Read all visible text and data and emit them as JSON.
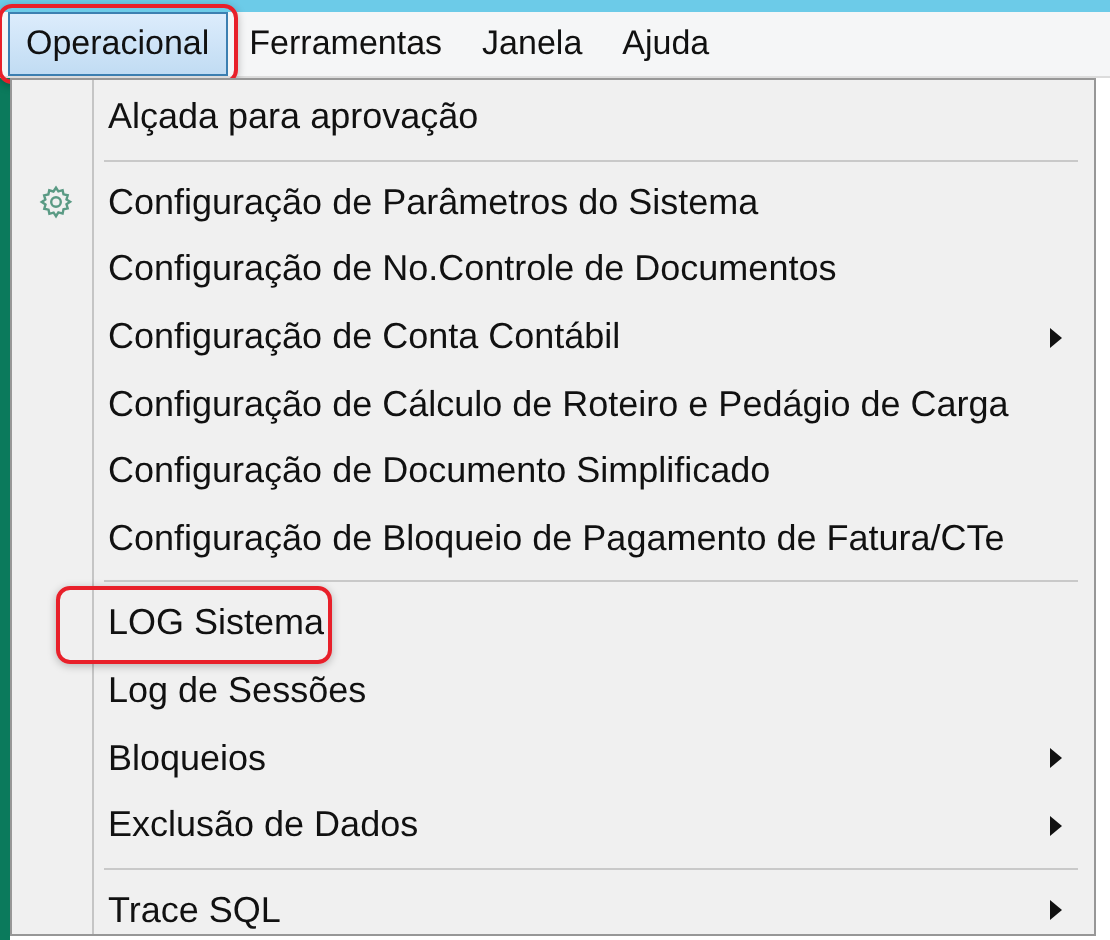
{
  "menubar": [
    {
      "label": "Operacional",
      "selected": true,
      "highlighted": true
    },
    {
      "label": "Ferramentas",
      "selected": false,
      "highlighted": false
    },
    {
      "label": "Janela",
      "selected": false,
      "highlighted": false
    },
    {
      "label": "Ajuda",
      "selected": false,
      "highlighted": false
    }
  ],
  "menu": [
    {
      "kind": "item",
      "label": "Alçada para aprovação",
      "has_icon": false,
      "has_submenu": false,
      "highlighted": false
    },
    {
      "kind": "separator"
    },
    {
      "kind": "item",
      "label": "Configuração de Parâmetros do Sistema",
      "has_icon": true,
      "has_submenu": false,
      "highlighted": false
    },
    {
      "kind": "item",
      "label": "Configuração de No.Controle de Documentos",
      "has_icon": false,
      "has_submenu": false,
      "highlighted": false
    },
    {
      "kind": "item",
      "label": "Configuração de Conta Contábil",
      "has_icon": false,
      "has_submenu": true,
      "highlighted": false
    },
    {
      "kind": "item",
      "label": "Configuração de Cálculo de Roteiro e Pedágio de Carga",
      "has_icon": false,
      "has_submenu": false,
      "highlighted": false
    },
    {
      "kind": "item",
      "label": "Configuração de Documento Simplificado",
      "has_icon": false,
      "has_submenu": false,
      "highlighted": false
    },
    {
      "kind": "item",
      "label": "Configuração de Bloqueio de Pagamento de Fatura/CTe",
      "has_icon": false,
      "has_submenu": false,
      "highlighted": false
    },
    {
      "kind": "separator"
    },
    {
      "kind": "item",
      "label": "LOG Sistema",
      "has_icon": false,
      "has_submenu": false,
      "highlighted": true
    },
    {
      "kind": "item",
      "label": "Log de Sessões",
      "has_icon": false,
      "has_submenu": false,
      "highlighted": false
    },
    {
      "kind": "item",
      "label": "Bloqueios",
      "has_icon": false,
      "has_submenu": true,
      "highlighted": false
    },
    {
      "kind": "item",
      "label": "Exclusão de Dados",
      "has_icon": false,
      "has_submenu": true,
      "highlighted": false
    },
    {
      "kind": "separator"
    },
    {
      "kind": "item",
      "label": "Trace SQL",
      "has_icon": false,
      "has_submenu": true,
      "highlighted": false
    }
  ]
}
